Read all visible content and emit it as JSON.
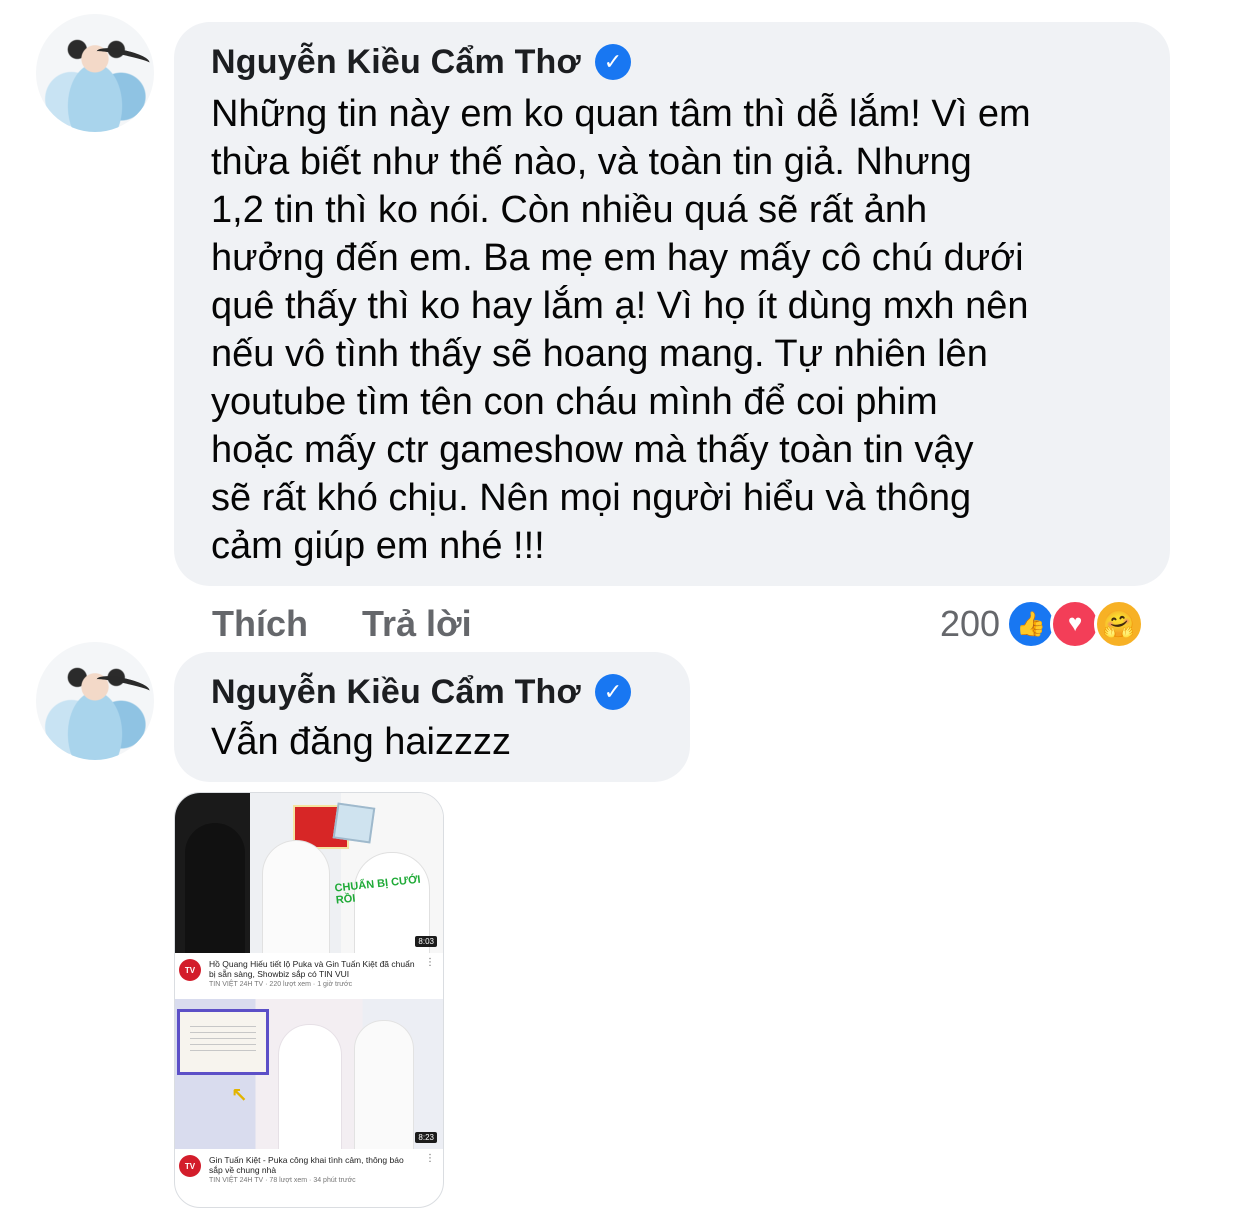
{
  "comments": [
    {
      "author": "Nguyễn Kiều Cẩm Thơ",
      "verified_icon": "check-badge-icon",
      "text": "Những tin này em ko quan tâm thì dễ lắm! Vì em\nthừa biết như thế nào, và toàn tin giả. Nhưng\n1,2 tin thì ko nói. Còn nhiều quá sẽ rất ảnh\nhưởng đến em. Ba mẹ em hay mấy cô chú dưới\nquê thấy thì ko hay lắm ạ! Vì họ ít dùng mxh nên\nnếu vô tình thấy sẽ hoang mang. Tự nhiên lên\nyoutube tìm tên con cháu mình để coi phim\nhoặc mấy ctr gameshow mà thấy toàn tin vậy\nsẽ rất khó chịu. Nên mọi người hiểu và thông\ncảm giúp em nhé !!!",
      "actions": {
        "like": "Thích",
        "reply": "Trả lời"
      },
      "reaction_count": "200",
      "reaction_icons": [
        "like-icon",
        "love-icon",
        "care-icon"
      ]
    },
    {
      "author": "Nguyễn Kiều Cẩm Thơ",
      "verified_icon": "check-badge-icon",
      "text": "Vẫn đăng haizzzz"
    }
  ],
  "attachment": {
    "videos": [
      {
        "overlay_text": "CHUẨN BỊ CƯỚI RỒI",
        "duration": "8:03",
        "title": "Hồ Quang Hiếu tiết lộ Puka và Gin Tuấn Kiệt đã chuẩn bị sẵn sàng, Showbiz sắp có TIN VUI",
        "channel_meta": "TIN VIỆT 24H TV · 220 lượt xem · 1 giờ trước",
        "channel_logo": "TV"
      },
      {
        "duration": "8:23",
        "title": "Gin Tuấn Kiệt - Puka công khai tình cảm, thông báo sắp về chung nhà",
        "channel_meta": "TIN VIỆT 24H TV · 78 lượt xem · 34 phút trước",
        "channel_logo": "TV"
      }
    ]
  },
  "colors": {
    "bubble_bg": "#f0f2f5",
    "verified_blue": "#1877f2",
    "secondary_text": "#65676b",
    "love_red": "#f33e58",
    "care_yellow": "#f7b125"
  }
}
